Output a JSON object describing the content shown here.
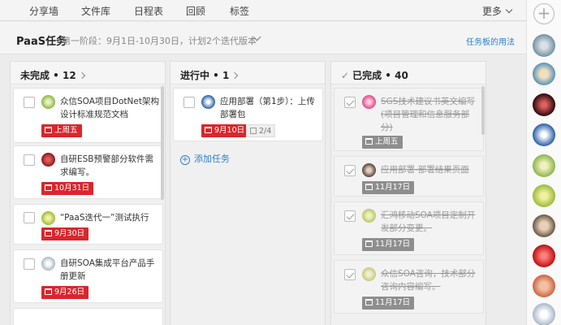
{
  "nav": {
    "items": [
      "分享墙",
      "文件库",
      "日程表",
      "回顾",
      "标签"
    ],
    "more": "更多"
  },
  "titlebar": {
    "title": "PaaS任务",
    "subtitle": "第一阶段：9月1日-10月30日，计划2个迭代版本",
    "help_link": "任务板的用法"
  },
  "columns": [
    {
      "name": "未完成 • 12",
      "cards": [
        {
          "text": "众信SOA项目DotNet架构设计标准规范文档",
          "due": "上周五",
          "avatar_color": "#8ab64a"
        },
        {
          "text": "自研ESB预警部分软件需求编写。",
          "due": "10月31日",
          "avatar_color": "#b8252d"
        },
        {
          "text": "“PaaS迭代一”测试执行",
          "due": "9月30日",
          "avatar_color": "#9cbb3a"
        },
        {
          "text": "自研SOA集成平台产品手册更新",
          "due": "9月26日",
          "avatar_color": "#c8d5e0"
        }
      ]
    },
    {
      "name": "进行中 • 1",
      "cards": [
        {
          "text": "应用部署（第1步）：上传部署包",
          "due": "9月10日",
          "subtasks": "2/4",
          "avatar_color": "#2a5fa8"
        }
      ],
      "add_task": "添加任务"
    },
    {
      "name": "已完成 • 40",
      "cards": [
        {
          "text": "SGS技术建议书英文编写(项目管理和信息服务部分)",
          "due": "上周五",
          "avatar_color": "#e04a8a"
        },
        {
          "text": "应用部署-部署结果页面",
          "due": "11月17日",
          "avatar_color": "#7a5a5a"
        },
        {
          "text": "汇鸿移动SOA项目定制开发部分变更。",
          "due": "11月17日",
          "avatar_color": "#b8c86a"
        },
        {
          "text": "众信SOA咨询，技术部分咨询内容编写。",
          "due": "11月17日",
          "avatar_color": "#c8c87a"
        }
      ]
    }
  ],
  "sidebar": {
    "add_icon": "+",
    "member_colors": [
      "#6a8a9a",
      "#4a8ab8",
      "#b8252d",
      "#2a5fa8",
      "#8ab64a",
      "#9cbb3a",
      "#5a4a3a",
      "#d92020",
      "#c85a3a",
      "#c8d5e0"
    ]
  },
  "colors": {
    "due_red": "#d9262c",
    "due_grey": "#8e8e8e",
    "link_blue": "#2a7fd4"
  }
}
